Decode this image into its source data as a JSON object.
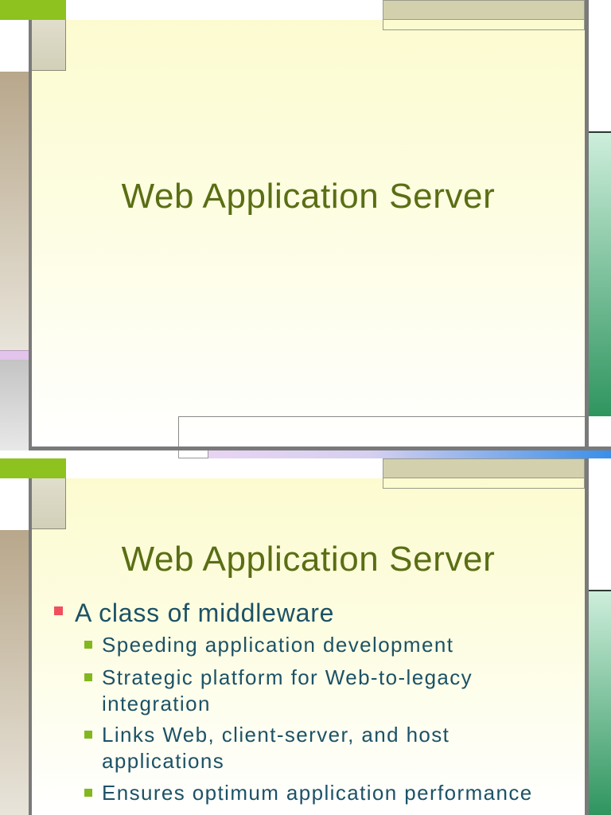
{
  "slides": [
    {
      "title": "Web Application Server"
    },
    {
      "title": "Web Application Server",
      "bullets": [
        {
          "text": "A class of middleware",
          "sub": [
            {
              "lines": [
                "Speeding application development"
              ]
            },
            {
              "lines": [
                "Strategic platform for Web-to-legacy",
                "integration"
              ]
            },
            {
              "lines": [
                "Links Web, client-server, and host",
                "applications"
              ]
            },
            {
              "lines": [
                "Ensures optimum application performance"
              ]
            }
          ]
        }
      ]
    }
  ],
  "colors": {
    "title": "#5a6e14",
    "bullet_text": "#1c5266",
    "main_bullet_marker": "#f0505e",
    "sub_bullet_marker": "#82b81e",
    "accent_green": "#8dc21f",
    "accent_tan": "#d3d1ad"
  }
}
